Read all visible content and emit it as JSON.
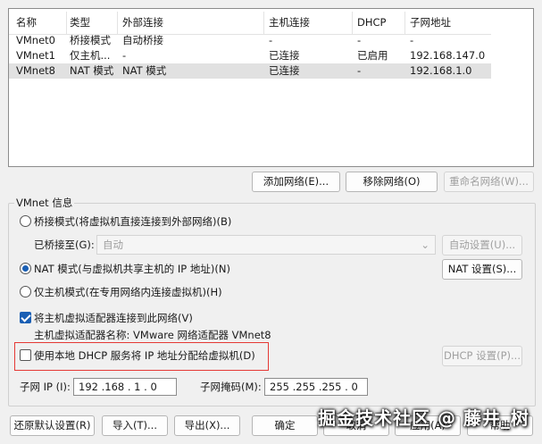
{
  "table": {
    "columns": [
      "名称",
      "类型",
      "外部连接",
      "主机连接",
      "DHCP",
      "子网地址"
    ],
    "rows": [
      [
        "VMnet0",
        "桥接模式",
        "自动桥接",
        "-",
        "-",
        "-"
      ],
      [
        "VMnet1",
        "仅主机...",
        "-",
        "已连接",
        "已启用",
        "192.168.147.0"
      ],
      [
        "VMnet8",
        "NAT 模式",
        "NAT 模式",
        "已连接",
        "-",
        "192.168.1.0"
      ]
    ],
    "selected_row": 2
  },
  "table_buttons": {
    "add": "添加网络(E)...",
    "remove": "移除网络(O)",
    "rename": "重命名网络(W)..."
  },
  "vmnet_info": {
    "title": "VMnet 信息",
    "bridged_label": "桥接模式(将虚拟机直接连接到外部网络)(B)",
    "bridged_to_label": "已桥接至(G):",
    "bridged_to_value": "自动",
    "auto_settings": "自动设置(U)...",
    "nat_label": "NAT 模式(与虚拟机共享主机的 IP 地址)(N)",
    "nat_settings": "NAT 设置(S)...",
    "host_only_label": "仅主机模式(在专用网络内连接虚拟机)(H)",
    "connect_adapter_label": "将主机虚拟适配器连接到此网络(V)",
    "adapter_name_label": "主机虚拟适配器名称: VMware 网络适配器 VMnet8",
    "dhcp_label": "使用本地 DHCP 服务将 IP 地址分配给虚拟机(D)",
    "dhcp_settings": "DHCP 设置(P)...",
    "subnet_ip_label": "子网 IP (I):",
    "subnet_ip_value": "192 .168 . 1 . 0",
    "subnet_mask_label": "子网掩码(M):",
    "subnet_mask_value": "255 .255 .255 . 0",
    "mode": "nat",
    "connect_adapter_checked": true,
    "dhcp_checked": false
  },
  "footer": {
    "restore_defaults": "还原默认设置(R)",
    "import": "导入(T)...",
    "export": "导出(X)...",
    "ok": "确定",
    "cancel": "取消",
    "apply": "应用(A)",
    "help": "帮助"
  },
  "watermark": "掘金技术社区 @ 藤井_树",
  "colors": {
    "accent": "#1a5fb4",
    "highlight_box": "#e53935",
    "selected_row": "#e1e1e1"
  },
  "icons": {
    "combo_chevron": "chevron-down-icon"
  }
}
